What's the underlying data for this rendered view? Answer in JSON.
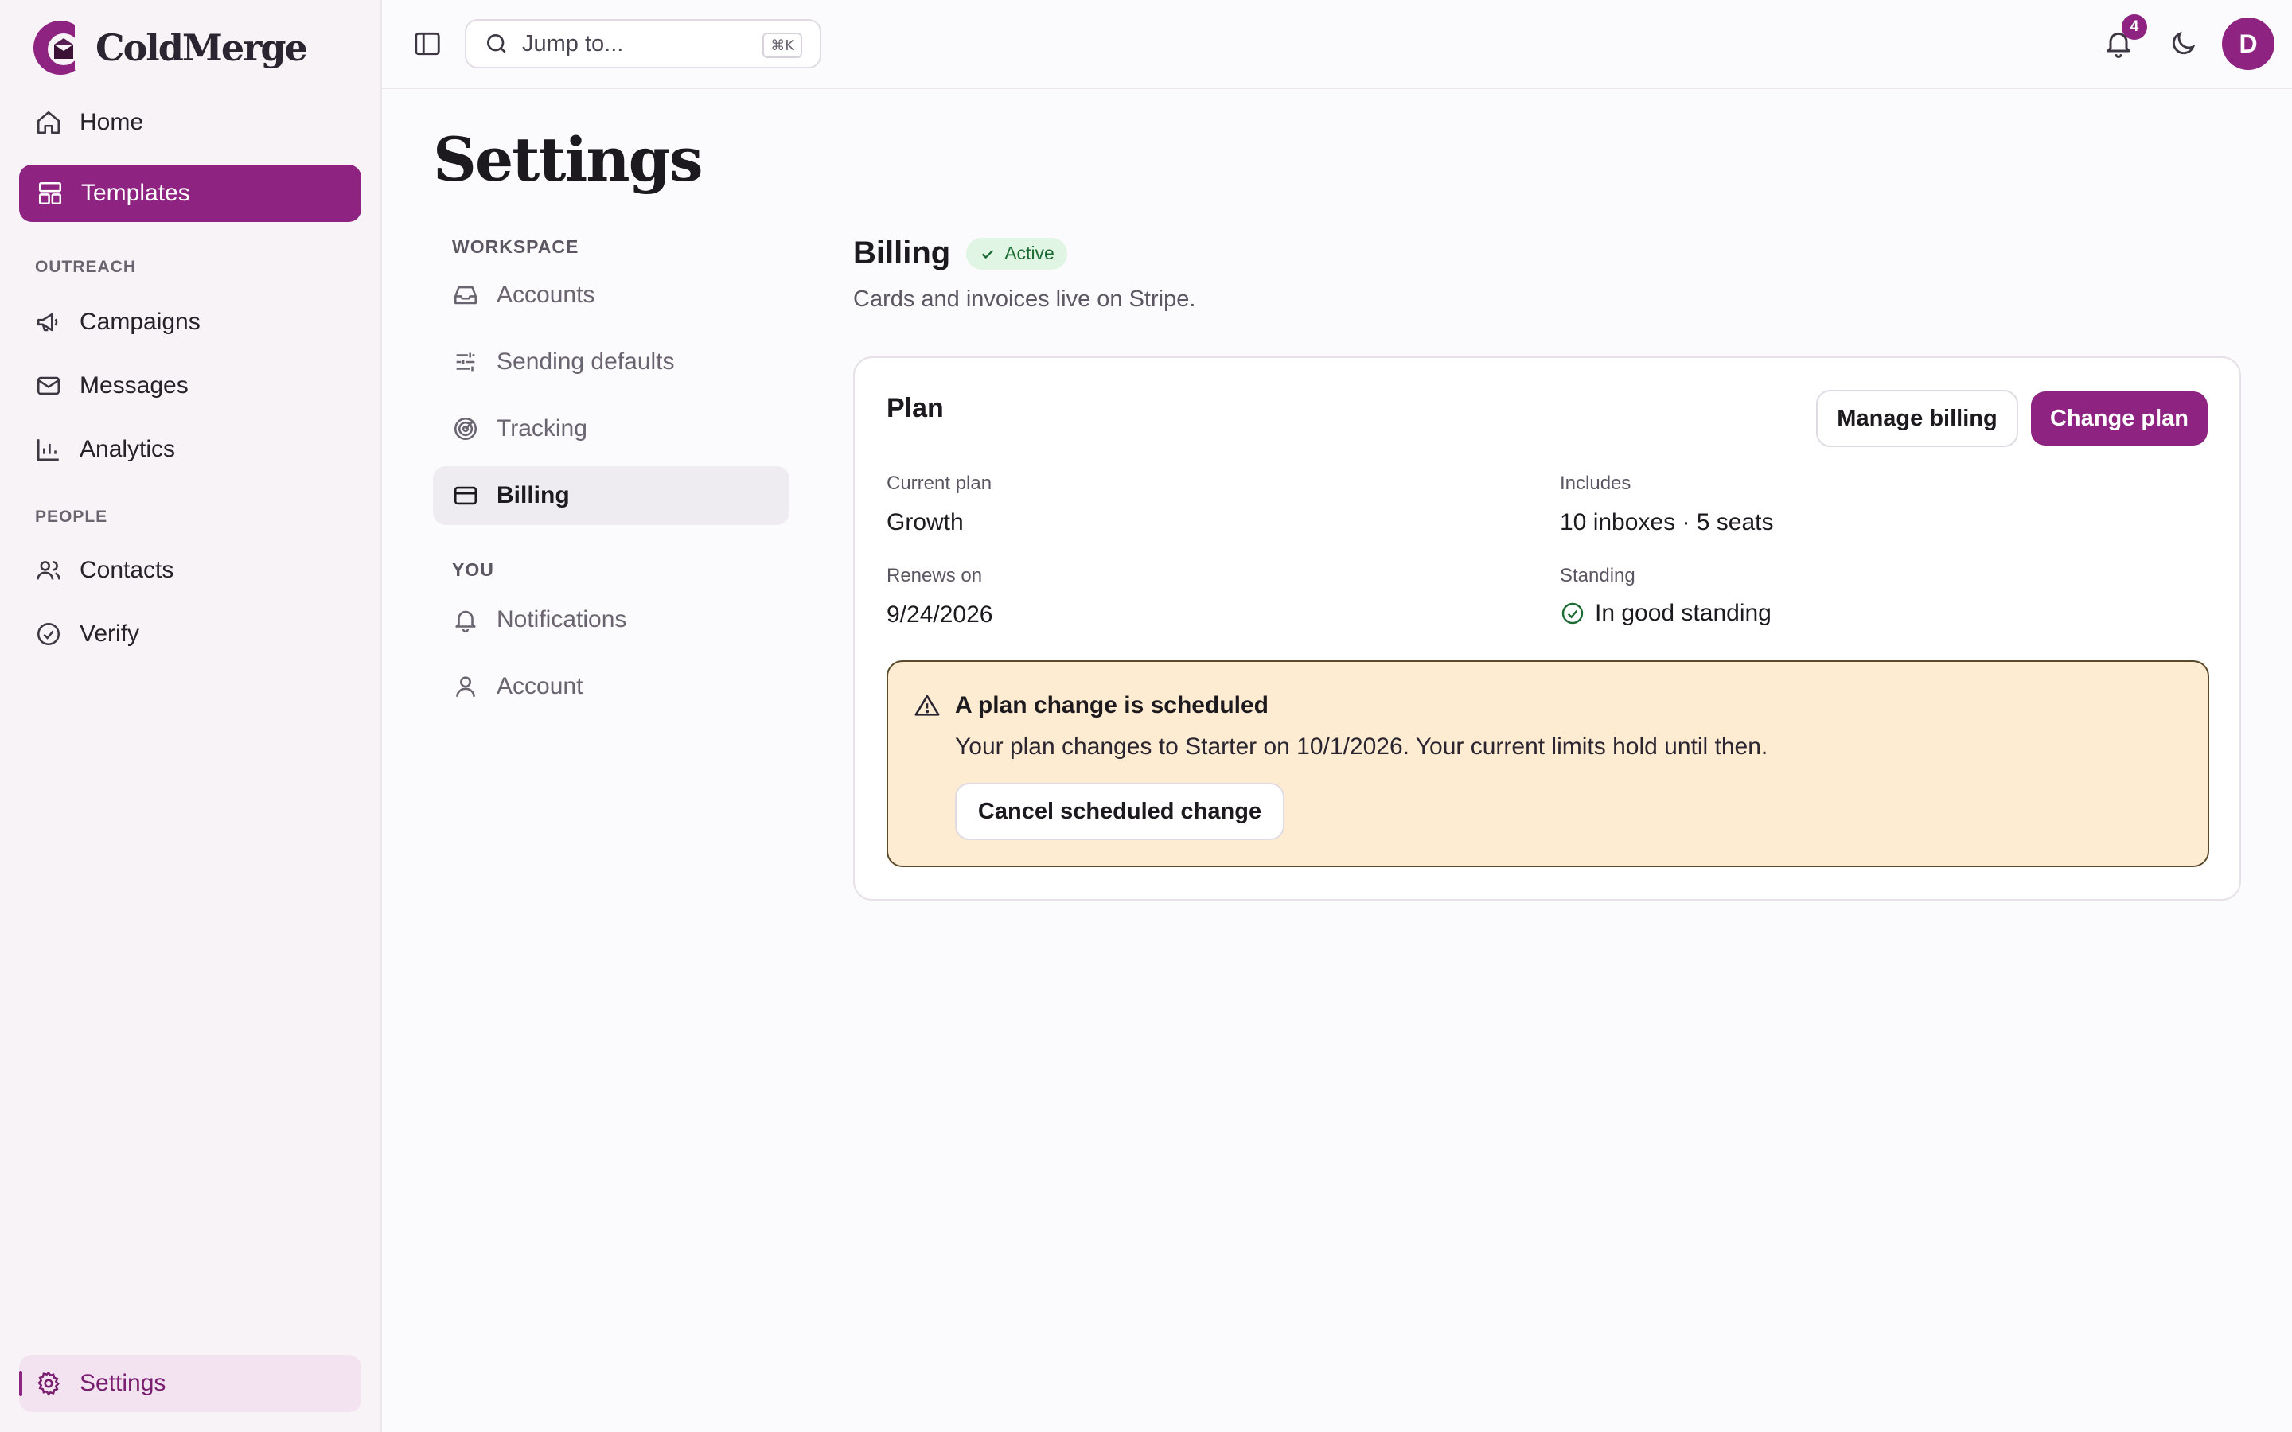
{
  "app": {
    "brand": "ColdMerge",
    "accent_color": "#8e2381"
  },
  "sidebar": {
    "items": [
      {
        "label": "Home",
        "icon": "home-icon"
      },
      {
        "label": "Templates",
        "icon": "layout-icon",
        "active": true
      }
    ],
    "sections": [
      {
        "label": "OUTREACH",
        "items": [
          {
            "label": "Campaigns",
            "icon": "megaphone-icon"
          },
          {
            "label": "Messages",
            "icon": "mail-icon"
          },
          {
            "label": "Analytics",
            "icon": "bar-chart-icon"
          }
        ]
      },
      {
        "label": "PEOPLE",
        "items": [
          {
            "label": "Contacts",
            "icon": "users-icon"
          },
          {
            "label": "Verify",
            "icon": "check-circle-icon"
          }
        ]
      }
    ],
    "footer": {
      "label": "Settings",
      "icon": "gear-icon"
    }
  },
  "topbar": {
    "search_placeholder": "Jump to...",
    "search_shortcut": "⌘K",
    "notification_count": "4",
    "avatar_initial": "D"
  },
  "page": {
    "title": "Settings"
  },
  "settings_nav": {
    "groups": [
      {
        "label": "WORKSPACE",
        "items": [
          {
            "label": "Accounts",
            "icon": "inbox-icon"
          },
          {
            "label": "Sending defaults",
            "icon": "sliders-icon"
          },
          {
            "label": "Tracking",
            "icon": "target-icon"
          },
          {
            "label": "Billing",
            "icon": "credit-card-icon",
            "active": true
          }
        ]
      },
      {
        "label": "YOU",
        "items": [
          {
            "label": "Notifications",
            "icon": "bell-icon"
          },
          {
            "label": "Account",
            "icon": "user-icon"
          }
        ]
      }
    ]
  },
  "billing": {
    "title": "Billing",
    "status": "Active",
    "description": "Cards and invoices live on Stripe.",
    "plan_card": {
      "title": "Plan",
      "manage_label": "Manage billing",
      "change_label": "Change plan",
      "fields": {
        "current_plan": {
          "label": "Current plan",
          "value": "Growth"
        },
        "includes": {
          "label": "Includes",
          "value": "10 inboxes · 5 seats"
        },
        "renews_on": {
          "label": "Renews on",
          "value": "9/24/2026"
        },
        "standing": {
          "label": "Standing",
          "value": "In good standing"
        }
      },
      "notice": {
        "title": "A plan change is scheduled",
        "body": "Your plan changes to Starter on 10/1/2026. Your current limits hold until then.",
        "action_label": "Cancel scheduled change"
      }
    }
  }
}
